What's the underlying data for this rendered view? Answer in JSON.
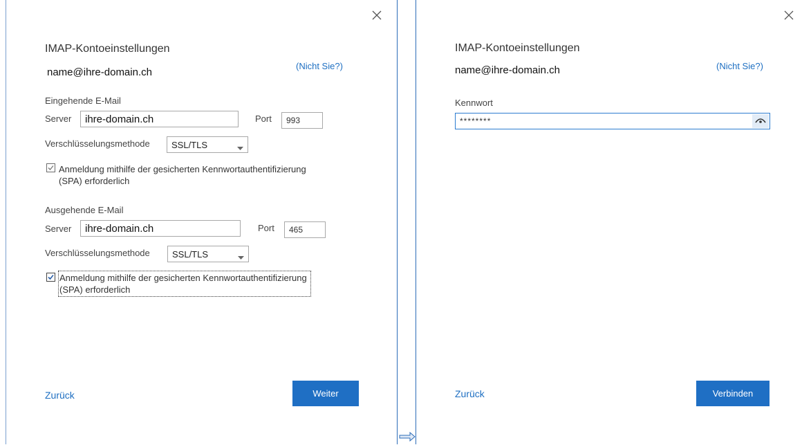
{
  "left_dialog": {
    "title": "IMAP-Kontoeinstellungen",
    "account": "name@ihre-domain.ch",
    "not_you": "(Nicht Sie?)",
    "incoming": {
      "section": "Eingehende E-Mail",
      "server_label": "Server",
      "server_value": "ihre-domain.ch",
      "port_label": "Port",
      "port_value": "993",
      "encryption_label": "Verschlüsselungsmethode",
      "encryption_value": "SSL/TLS",
      "spa_line1": "Anmeldung mithilfe der gesicherten Kennwortauthentifizierung",
      "spa_line2": "(SPA) erforderlich",
      "spa_checked": true
    },
    "outgoing": {
      "section": "Ausgehende E-Mail",
      "server_label": "Server",
      "server_value": "ihre-domain.ch",
      "port_label": "Port",
      "port_value": "465",
      "encryption_label": "Verschlüsselungsmethode",
      "encryption_value": "SSL/TLS",
      "spa_line1": "Anmeldung mithilfe der gesicherten Kennwortauthentifizierung",
      "spa_line2": "(SPA) erforderlich",
      "spa_checked": true
    },
    "back": "Zurück",
    "next": "Weiter"
  },
  "right_dialog": {
    "title": "IMAP-Kontoeinstellungen",
    "account": "name@ihre-domain.ch",
    "not_you": "(Nicht Sie?)",
    "password_label": "Kennwort",
    "password_value": "********",
    "back": "Zurück",
    "connect": "Verbinden"
  },
  "icons": {
    "close": "close-icon",
    "dropdown": "chevron-down-icon",
    "check": "checkmark-icon",
    "reveal_password": "eye-icon",
    "flow": "arrow-right-icon"
  },
  "colors": {
    "accent": "#1f6fc4",
    "link": "#1e6fc2",
    "panel_border": "#2b6cb8"
  }
}
